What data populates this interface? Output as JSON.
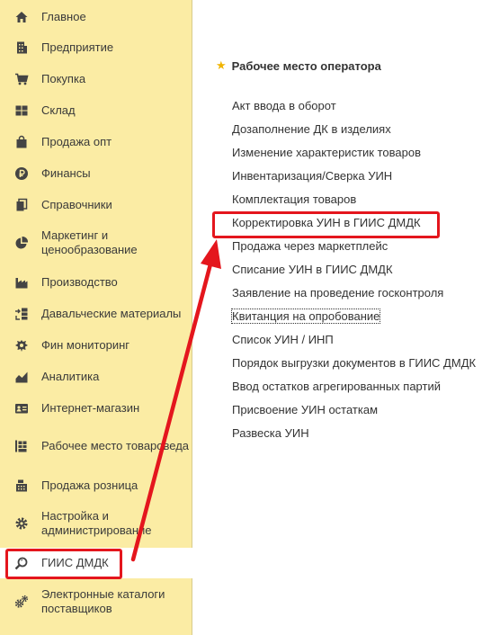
{
  "sidebar": {
    "items": [
      {
        "label": "Главное",
        "icon": "home-icon"
      },
      {
        "label": "Предприятие",
        "icon": "building-icon"
      },
      {
        "label": "Покупка",
        "icon": "cart-icon"
      },
      {
        "label": "Склад",
        "icon": "warehouse-icon"
      },
      {
        "label": "Продажа опт",
        "icon": "bag-icon"
      },
      {
        "label": "Финансы",
        "icon": "ruble-icon"
      },
      {
        "label": "Справочники",
        "icon": "books-icon"
      },
      {
        "label": "Маркетинг и ценообразование",
        "icon": "pie-chart-icon"
      },
      {
        "label": "Производство",
        "icon": "factory-icon"
      },
      {
        "label": "Давальческие материалы",
        "icon": "materials-icon"
      },
      {
        "label": "Фин мониторинг",
        "icon": "emblem-icon"
      },
      {
        "label": "Аналитика",
        "icon": "analytics-icon"
      },
      {
        "label": "Интернет-магазин",
        "icon": "id-card-icon"
      },
      {
        "label": "Рабочее место товароведа",
        "icon": "shelves-icon"
      },
      {
        "label": "Продажа розница",
        "icon": "register-icon"
      },
      {
        "label": "Настройка и администрирование",
        "icon": "gear-icon"
      },
      {
        "label": "ГИИС ДМДК",
        "icon": "magnifier-icon"
      },
      {
        "label": "Электронные каталоги поставщиков",
        "icon": "gears-icon"
      }
    ]
  },
  "main": {
    "title": "Рабочее место оператора",
    "commands": [
      "Акт ввода в оборот",
      "Дозаполнение ДК в изделиях",
      "Изменение характеристик товаров",
      "Инвентаризация/Сверка УИН",
      "Комплектация товаров",
      "Корректировка УИН в ГИИС ДМДК",
      "Продажа через маркетплейс",
      "Списание УИН в ГИИС ДМДК",
      "Заявление на проведение госконтроля",
      "Квитанция на опробование",
      "Список УИН / ИНП",
      "Порядок выгрузки документов в ГИИС ДМДК",
      "Ввод остатков агрегированных партий",
      "Присвоение УИН остаткам",
      "Развеска УИН"
    ]
  },
  "colors": {
    "sidebar_bg": "#fbeca4",
    "highlight": "#e4161d",
    "star": "#f0b400"
  }
}
